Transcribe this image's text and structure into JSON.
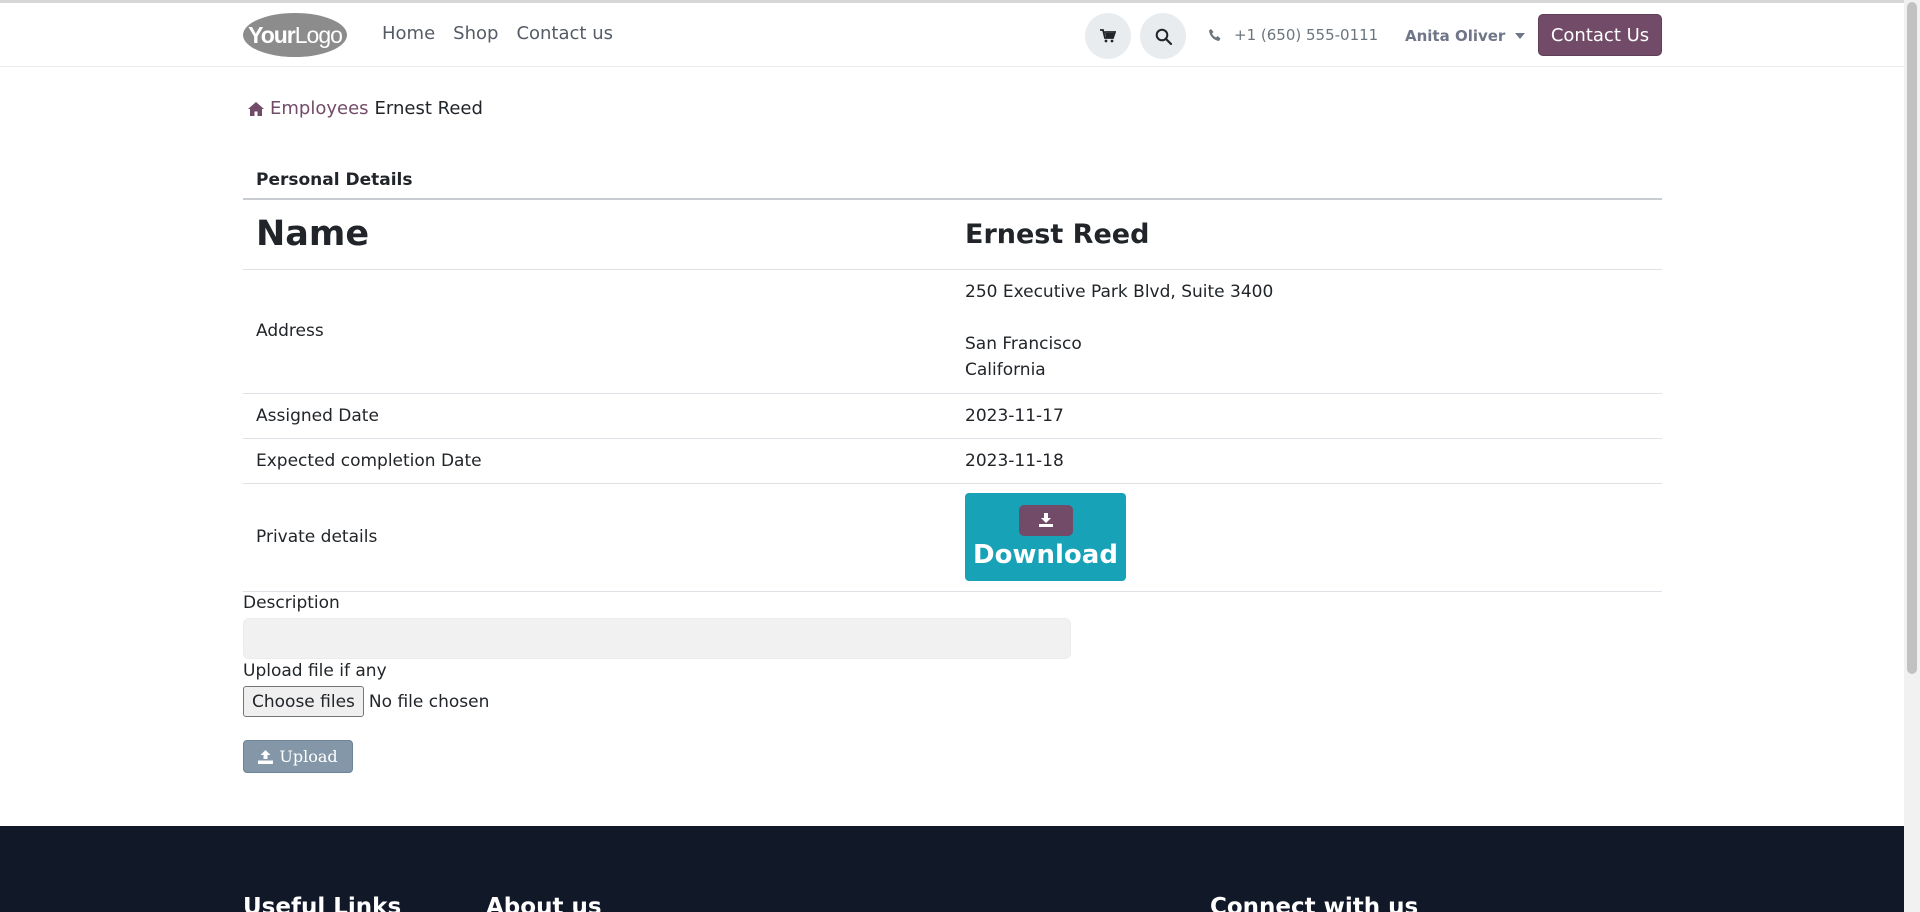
{
  "header": {
    "logo": {
      "bold": "Your",
      "light": "Logo"
    },
    "nav": [
      "Home",
      "Shop",
      "Contact us"
    ],
    "cart_icon": "cart-icon",
    "search_icon": "search-icon",
    "phone": "+1 (650) 555-0111",
    "user": "Anita Oliver",
    "cta": "Contact Us"
  },
  "breadcrumb": {
    "root": "Employees",
    "current": "Ernest Reed"
  },
  "details": {
    "section_title": "Personal Details",
    "name_label": "Name",
    "name_value": "Ernest Reed",
    "address_label": "Address",
    "address_lines": [
      "250 Executive Park Blvd, Suite 3400",
      "San Francisco",
      "California"
    ],
    "assigned_label": "Assigned Date",
    "assigned_value": "2023-11-17",
    "expected_label": "Expected completion Date",
    "expected_value": "2023-11-18",
    "private_label": "Private details",
    "download_label": "Download"
  },
  "form": {
    "description_label": "Description",
    "description_value": "",
    "upload_label": "Upload file if any",
    "choose_files": "Choose files",
    "no_file": "No file chosen",
    "upload_button": "Upload"
  },
  "footer": {
    "useful_links": "Useful Links",
    "about_us": "About us",
    "connect": "Connect with us"
  },
  "colors": {
    "brand": "#714b67",
    "download": "#17a2b8",
    "upload": "#8497a8",
    "footer": "#111827"
  }
}
